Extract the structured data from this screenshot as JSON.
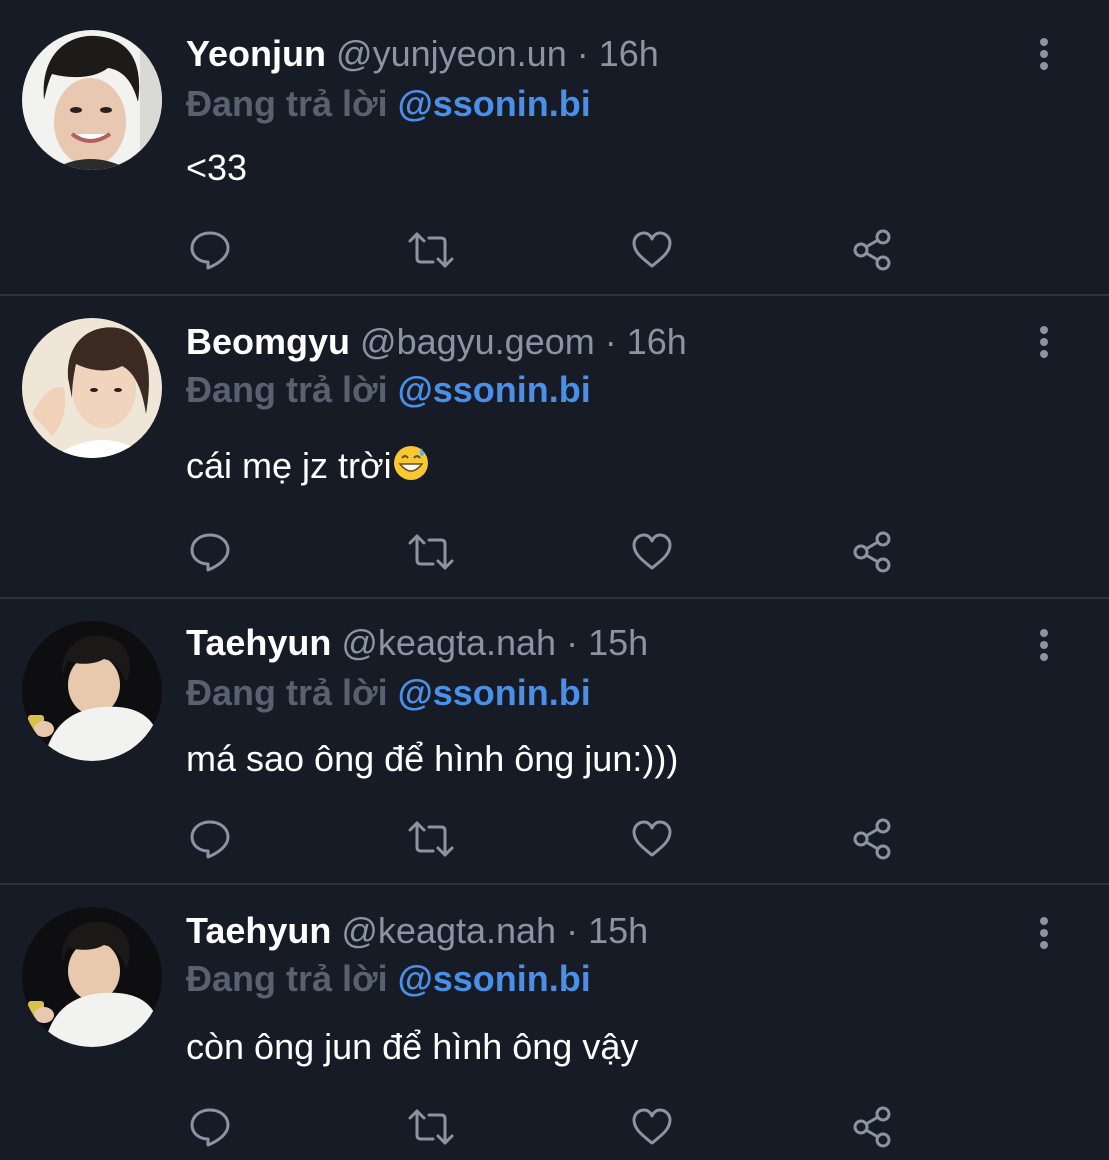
{
  "theme": {
    "background": "#161b26",
    "divider": "#2e3542",
    "secondary_text": "#8b94a3",
    "reply_label": "#596170",
    "mention": "#4a90e8",
    "icon": "#8b94a3"
  },
  "tweets": [
    {
      "name": "Yeonjun",
      "handle": "@yunjyeon.un",
      "separator": "·",
      "time": "16h",
      "reply_label": "Đang trả lời",
      "reply_to": "@ssonin.bi",
      "text": "<33"
    },
    {
      "name": "Beomgyu",
      "handle": "@bagyu.geom",
      "separator": "·",
      "time": "16h",
      "reply_label": "Đang trả lời",
      "reply_to": "@ssonin.bi",
      "text": "cái mẹ jz trời",
      "emoji": "grinning-face-with-sweat"
    },
    {
      "name": "Taehyun",
      "handle": "@keagta.nah",
      "separator": "·",
      "time": "15h",
      "reply_label": "Đang trả lời",
      "reply_to": "@ssonin.bi",
      "text": "má sao ông để hình ông jun:)))"
    },
    {
      "name": "Taehyun",
      "handle": "@keagta.nah",
      "separator": "·",
      "time": "15h",
      "reply_label": "Đang trả lời",
      "reply_to": "@ssonin.bi",
      "text": "còn ông jun để hình ông vậy"
    }
  ],
  "icons": {
    "reply": "speech-bubble-icon",
    "retweet": "retweet-icon",
    "like": "heart-icon",
    "share": "share-icon",
    "more": "vertical-dots-icon"
  }
}
